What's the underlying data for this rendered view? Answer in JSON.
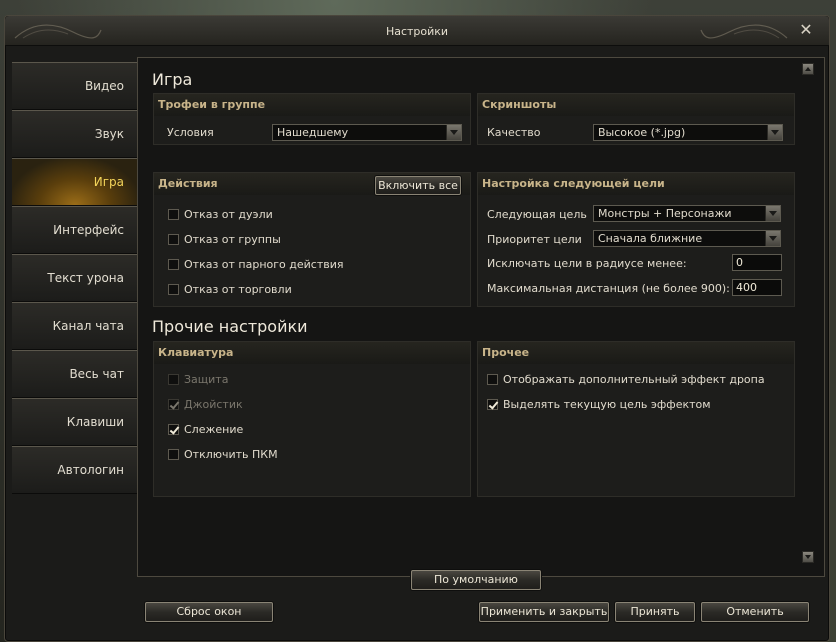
{
  "window": {
    "title": "Настройки"
  },
  "sidebar": {
    "items": [
      {
        "label": "Видео",
        "active": false
      },
      {
        "label": "Звук",
        "active": false
      },
      {
        "label": "Игра",
        "active": true
      },
      {
        "label": "Интерфейс",
        "active": false
      },
      {
        "label": "Текст урона",
        "active": false
      },
      {
        "label": "Канал чата",
        "active": false
      },
      {
        "label": "Весь чат",
        "active": false
      },
      {
        "label": "Клавиши",
        "active": false
      },
      {
        "label": "Автологин",
        "active": false
      }
    ]
  },
  "game": {
    "heading": "Игра",
    "loot": {
      "title": "Трофеи в группе",
      "condition_label": "Условия",
      "condition_value": "Нашедшему"
    },
    "screenshots": {
      "title": "Скриншоты",
      "quality_label": "Качество",
      "quality_value": "Высокое (*.jpg)"
    },
    "actions": {
      "title": "Действия",
      "enable_all": "Включить все",
      "items": [
        {
          "label": "Отказ от дуэли",
          "checked": false
        },
        {
          "label": "Отказ от группы",
          "checked": false
        },
        {
          "label": "Отказ от парного действия",
          "checked": false
        },
        {
          "label": "Отказ от торговли",
          "checked": false
        }
      ]
    },
    "next_target": {
      "title": "Настройка следующей цели",
      "next_label": "Следующая цель",
      "next_value": "Монстры + Персонажи",
      "priority_label": "Приоритет цели",
      "priority_value": "Сначала ближние",
      "exclude_label": "Исключать цели в радиусе менее:",
      "exclude_value": "0",
      "maxdist_label": "Максимальная дистанция (не более 900):",
      "maxdist_value": "400"
    }
  },
  "other": {
    "heading": "Прочие настройки",
    "keyboard": {
      "title": "Клавиатура",
      "items": [
        {
          "label": "Защита",
          "checked": false,
          "disabled": true
        },
        {
          "label": "Джойстик",
          "checked": true,
          "disabled": true
        },
        {
          "label": "Слежение",
          "checked": true,
          "disabled": false
        },
        {
          "label": "Отключить ПКМ",
          "checked": false,
          "disabled": false
        }
      ]
    },
    "misc": {
      "title": "Прочее",
      "items": [
        {
          "label": "Отображать дополнительный эффект дропа",
          "checked": false
        },
        {
          "label": "Выделять текущую цель эффектом",
          "checked": true
        }
      ]
    }
  },
  "buttons": {
    "defaults": "По умолчанию",
    "reset_windows": "Сброс окон",
    "apply_close": "Применить и закрыть",
    "apply": "Принять",
    "cancel": "Отменить"
  }
}
